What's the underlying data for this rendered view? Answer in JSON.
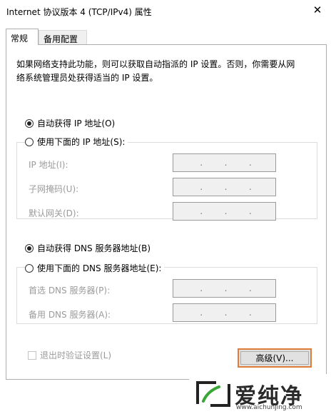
{
  "window": {
    "title": "Internet 协议版本 4 (TCP/IPv4) 属性",
    "close_glyph": "✕"
  },
  "tabs": [
    {
      "label": "常规",
      "active": true
    },
    {
      "label": "备用配置",
      "active": false
    }
  ],
  "description": {
    "line1": "如果网络支持此功能，则可以获取自动指派的 IP 设置。否则，你需要从网",
    "line2": "络系统管理员处获得适当的 IP 设置。"
  },
  "ip_section": {
    "auto_radio": {
      "label": "自动获得 IP 地址(O)",
      "selected": true
    },
    "manual_radio": {
      "label": "使用下面的 IP 地址(S):",
      "selected": false
    },
    "fields": [
      {
        "label": "IP 地址(I):",
        "value": ". . ."
      },
      {
        "label": "子网掩码(U):",
        "value": ". . ."
      },
      {
        "label": "默认网关(D):",
        "value": ". . ."
      }
    ]
  },
  "dns_section": {
    "auto_radio": {
      "label": "自动获得 DNS 服务器地址(B)",
      "selected": true
    },
    "manual_radio": {
      "label": "使用下面的 DNS 服务器地址(E):",
      "selected": false
    },
    "fields": [
      {
        "label": "首选 DNS 服务器(P):",
        "value": ". . ."
      },
      {
        "label": "备用 DNS 服务器(A):",
        "value": ". . ."
      }
    ]
  },
  "validate_checkbox": {
    "label": "退出时验证设置(L)",
    "checked": false,
    "enabled": false
  },
  "advanced_button": {
    "label": "高级(V)..."
  },
  "watermark": {
    "brand": "爱纯净",
    "url": "www.aichunjing.com",
    "accent_color": "#3aa635"
  },
  "colors": {
    "advanced_focus_border": "#e07c3a",
    "disabled_text": "#9b9b9b"
  }
}
